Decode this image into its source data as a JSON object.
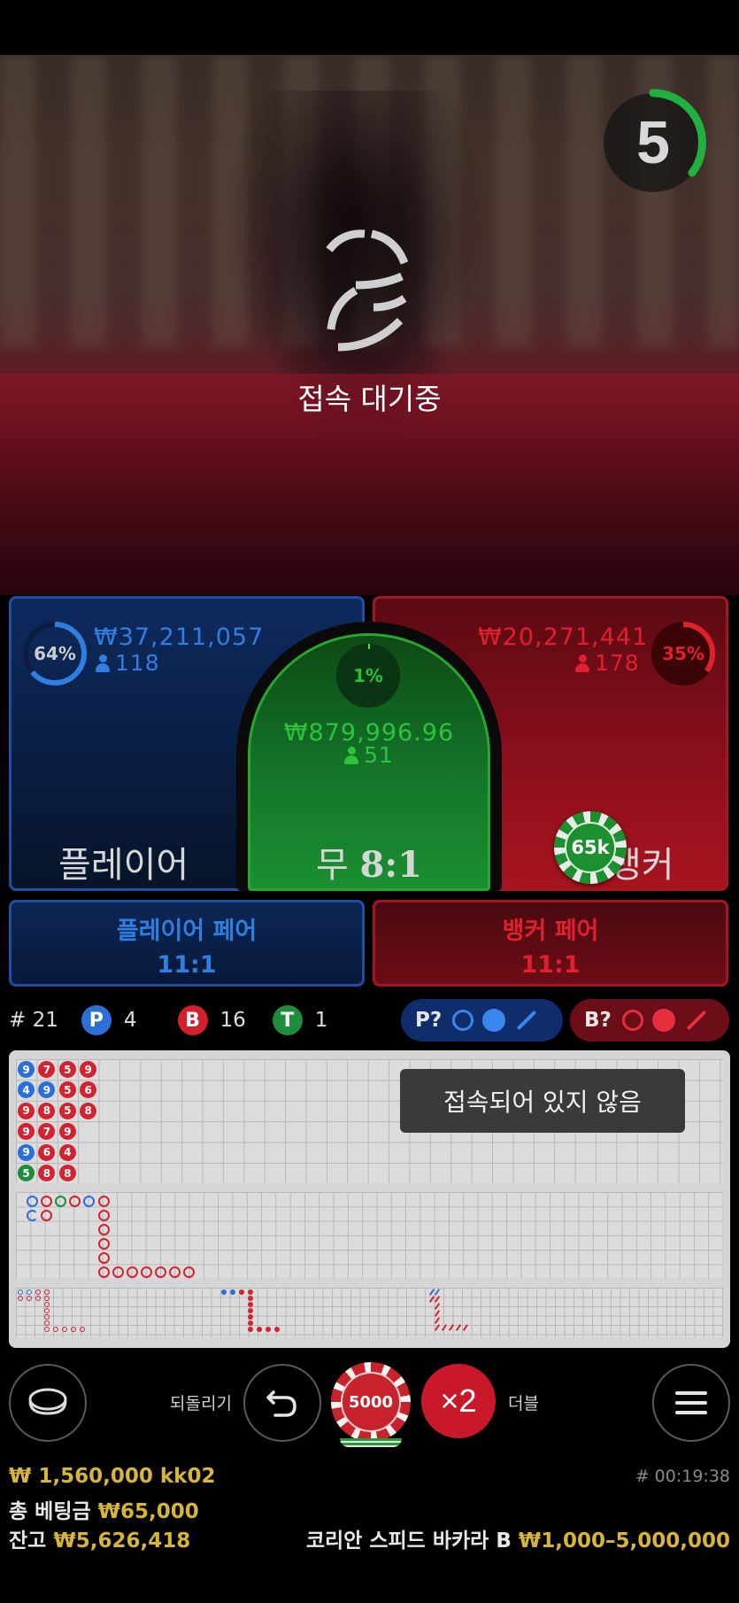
{
  "video": {
    "countdown": "5",
    "status_text": "접속 대기중"
  },
  "bets": {
    "player": {
      "percent": "64%",
      "amount": "₩37,211,057",
      "players": "118",
      "label": "플레이어",
      "color": "#2f7fe0"
    },
    "tie": {
      "percent": "1%",
      "amount": "₩879,996.96",
      "players": "51",
      "label": "무",
      "odds": "8:1",
      "color": "#2bb53a"
    },
    "banker": {
      "percent": "35%",
      "amount": "₩20,271,441",
      "players": "178",
      "label": "뱅커",
      "color": "#e0202e",
      "placed_chip": "65k"
    },
    "player_pair": {
      "label": "플레이어 페어",
      "odds": "11:1"
    },
    "banker_pair": {
      "label": "뱅커 페어",
      "odds": "11:1"
    }
  },
  "stats": {
    "round": "# 21",
    "p_badge": "P",
    "p_count": "4",
    "b_badge": "B",
    "b_count": "16",
    "t_badge": "T",
    "t_count": "1"
  },
  "predict": {
    "player_label": "P?",
    "banker_label": "B?"
  },
  "roadmap": {
    "bead_columns": [
      [
        [
          "9",
          "P"
        ],
        [
          "4",
          "P"
        ],
        [
          "9",
          "B"
        ],
        [
          "9",
          "B"
        ],
        [
          "9",
          "P"
        ],
        [
          "5",
          "T"
        ]
      ],
      [
        [
          "7",
          "B"
        ],
        [
          "9",
          "P"
        ],
        [
          "8",
          "B"
        ],
        [
          "7",
          "B"
        ],
        [
          "6",
          "B"
        ],
        [
          "8",
          "B"
        ]
      ],
      [
        [
          "5",
          "B"
        ],
        [
          "5",
          "B"
        ],
        [
          "5",
          "B"
        ],
        [
          "9",
          "B"
        ],
        [
          "4",
          "B"
        ],
        [
          "8",
          "B"
        ]
      ],
      [
        [
          "9",
          "B"
        ],
        [
          "6",
          "B"
        ],
        [
          "8",
          "B"
        ]
      ]
    ],
    "toast": "접속되어 있지 않음"
  },
  "controls": {
    "undo_label": "되돌리기",
    "chip_value": "5000",
    "double_symbol": "×2",
    "double_label": "더블"
  },
  "footer": {
    "win_line": "₩ 1,560,000 kk02",
    "total_bet_label": "총 베팅금",
    "total_bet_value": "₩65,000",
    "balance_label": "잔고",
    "balance_value": "₩5,626,418",
    "game_id": "# 00:19:38",
    "table_name": "코리안 스피드 바카라 B",
    "table_limits": "₩1,000–5,000,000"
  }
}
